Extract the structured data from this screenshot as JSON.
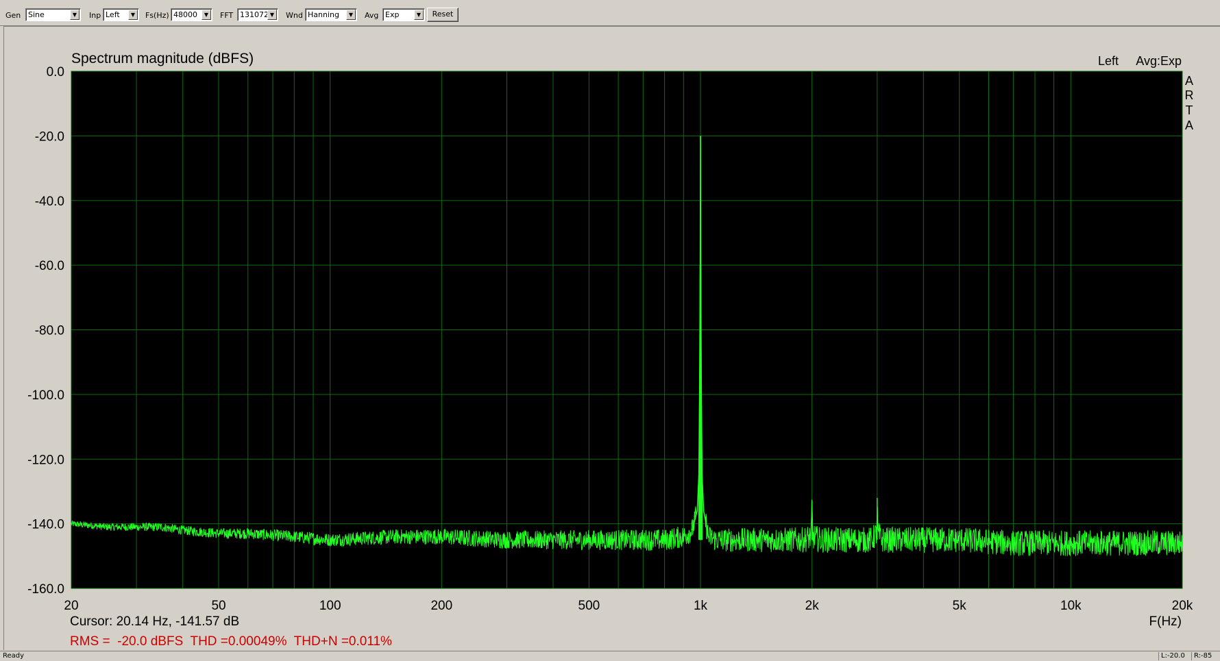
{
  "toolbar": {
    "gen_label": "Gen",
    "gen_value": "Sine",
    "inp_label": "Inp",
    "inp_value": "Left",
    "fs_label": "Fs(Hz)",
    "fs_value": "48000",
    "fft_label": "FFT",
    "fft_value": "131072",
    "wnd_label": "Wnd",
    "wnd_value": "Hanning",
    "avg_label": "Avg",
    "avg_value": "Exp",
    "reset_label": "Reset"
  },
  "chart_header": {
    "channel": "Left",
    "avg": "Avg:Exp",
    "brand_letters": [
      "A",
      "R",
      "T",
      "A"
    ]
  },
  "readout": {
    "cursor": "Cursor: 20.14 Hz, -141.57 dB",
    "measurements": "RMS =  -20.0 dBFS  THD =0.00049%  THD+N =0.011%"
  },
  "status": {
    "text": "Ready",
    "pane1": "L:-20.0",
    "pane2": "R:-85"
  },
  "colors": {
    "plot_bg": "#000000",
    "grid": "#0a6e0a",
    "trace": "#22ff22",
    "readout_red": "#cc0000"
  },
  "chart_data": {
    "type": "line",
    "title": "Spectrum magnitude (dBFS)",
    "xlabel": "F(Hz)",
    "ylabel": "",
    "xscale": "log",
    "xlim": [
      20,
      20000
    ],
    "ylim": [
      -160,
      0
    ],
    "x_ticks": [
      20,
      50,
      100,
      200,
      500,
      1000,
      2000,
      5000,
      10000,
      20000
    ],
    "x_tick_labels": [
      "20",
      "50",
      "100",
      "200",
      "500",
      "1k",
      "2k",
      "5k",
      "10k",
      "20k"
    ],
    "y_ticks": [
      0,
      -20,
      -40,
      -60,
      -80,
      -100,
      -120,
      -140,
      -160
    ],
    "y_tick_labels": [
      "0.0",
      "-20.0",
      "-40.0",
      "-60.0",
      "-80.0",
      "-100.0",
      "-120.0",
      "-140.0",
      "-160.0"
    ],
    "grid": true,
    "series": [
      {
        "x": [
          20,
          25,
          30,
          35,
          40,
          50,
          60,
          80,
          100,
          150,
          200,
          300,
          400,
          500,
          600,
          700,
          800,
          900,
          950,
          980,
          990,
          995,
          998,
          1000,
          1002,
          1005,
          1010,
          1020,
          1050,
          1100,
          1200,
          1500,
          1900,
          1990,
          2000,
          2010,
          2100,
          2500,
          2900,
          2990,
          3000,
          3010,
          3100,
          4000,
          5000,
          7000,
          10000,
          15000,
          20000
        ],
        "y": [
          -140,
          -141,
          -141,
          -141,
          -142,
          -143,
          -143,
          -144,
          -145,
          -144,
          -144,
          -145,
          -145,
          -145,
          -145,
          -145,
          -145,
          -144,
          -142,
          -136,
          -125,
          -94,
          -60,
          -20,
          -60,
          -94,
          -125,
          -136,
          -144,
          -145,
          -145,
          -145,
          -145,
          -144,
          -133,
          -144,
          -145,
          -145,
          -145,
          -143,
          -132,
          -143,
          -145,
          -145,
          -145,
          -146,
          -146,
          -146,
          -146
        ]
      }
    ]
  }
}
